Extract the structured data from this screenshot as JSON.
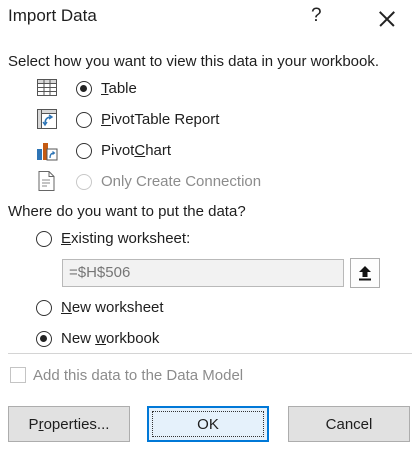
{
  "dialog": {
    "title": "Import Data",
    "help_label": "?"
  },
  "view_section": {
    "label": "Select how you want to view this data in your workbook.",
    "options": [
      {
        "label": "Table",
        "mnemonic": "T",
        "rest": "able",
        "icon": "table-icon",
        "selected": true,
        "enabled": true
      },
      {
        "label": "PivotTable Report",
        "mnemonic": "P",
        "rest": "ivotTable Report",
        "icon": "pivottable-icon",
        "selected": false,
        "enabled": true
      },
      {
        "label": "PivotChart",
        "pre": "Pivot",
        "mnemonic": "C",
        "rest": "hart",
        "icon": "pivotchart-icon",
        "selected": false,
        "enabled": true
      },
      {
        "label": "Only Create Connection",
        "icon": "connection-icon",
        "selected": false,
        "enabled": false
      }
    ]
  },
  "location_section": {
    "label": "Where do you want to put the data?",
    "existing": {
      "label": "Existing worksheet:",
      "mnemonic": "E",
      "rest": "xisting worksheet:",
      "selected": false
    },
    "reference_value": "=$H$506",
    "new_worksheet": {
      "label": "New worksheet",
      "mnemonic": "N",
      "rest": "ew worksheet",
      "selected": false
    },
    "new_workbook": {
      "label": "New workbook",
      "pre": "New ",
      "mnemonic": "w",
      "rest": "orkbook",
      "selected": true
    }
  },
  "data_model": {
    "label": "Add this data to the Data Model",
    "checked": false,
    "enabled": false
  },
  "buttons": {
    "properties": {
      "pre": "P",
      "mnemonic": "r",
      "rest": "operties...",
      "label": "Properties..."
    },
    "ok": "OK",
    "cancel": "Cancel"
  },
  "colors": {
    "accent": "#0078d7",
    "disabled_text": "#8c8c8c"
  }
}
